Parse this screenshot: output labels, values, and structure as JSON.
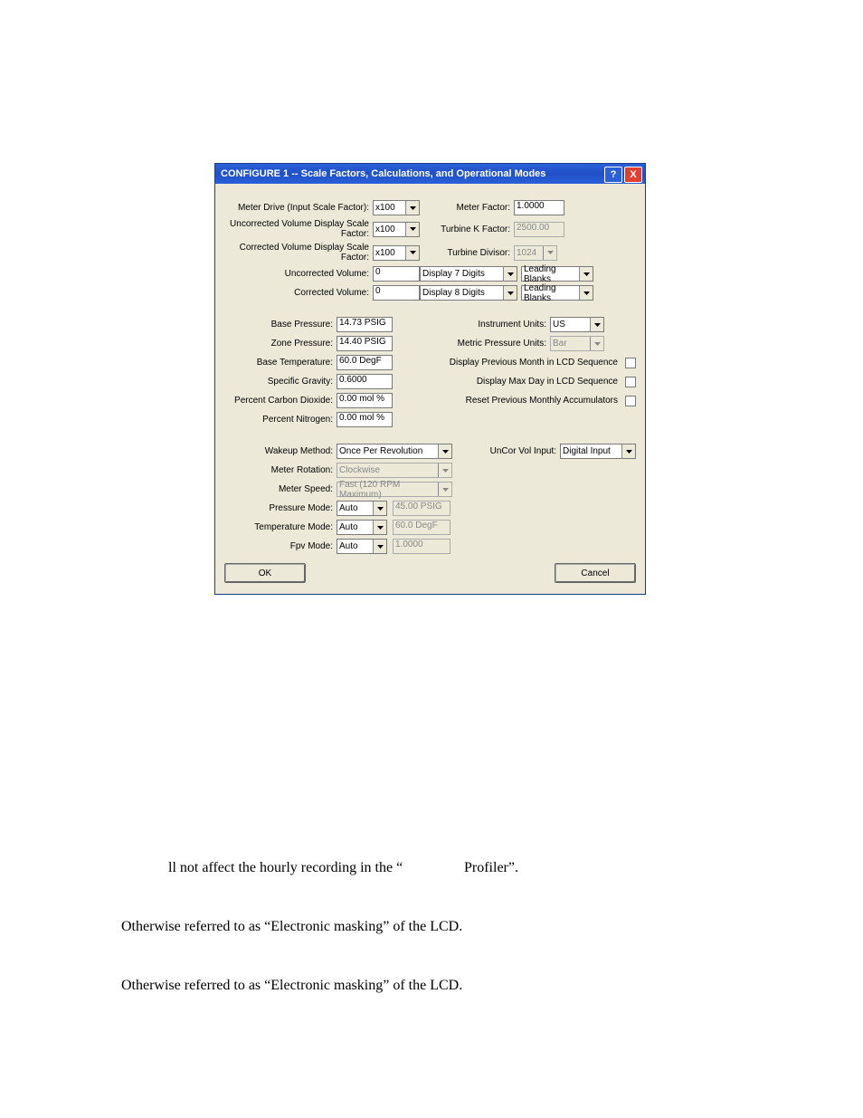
{
  "dialog": {
    "title": "CONFIGURE 1 -- Scale Factors, Calculations, and Operational Modes",
    "help": "?",
    "close": "X"
  },
  "left": {
    "meter_drive_lbl": "Meter Drive (Input Scale Factor):",
    "meter_drive_val": "x100",
    "uncorr_disp_lbl": "Uncorrected Volume Display Scale Factor:",
    "uncorr_disp_val": "x100",
    "corr_disp_lbl": "Corrected Volume Display Scale Factor:",
    "corr_disp_val": "x100",
    "uncorr_vol_lbl": "Uncorrected Volume:",
    "uncorr_vol_val": "0",
    "corr_vol_lbl": "Corrected Volume:",
    "corr_vol_val": "0",
    "base_pressure_lbl": "Base Pressure:",
    "base_pressure_val": "14.73 PSIG",
    "zone_pressure_lbl": "Zone Pressure:",
    "zone_pressure_val": "14.40 PSIG",
    "base_temp_lbl": "Base Temperature:",
    "base_temp_val": "60.0 DegF",
    "specific_gravity_lbl": "Specific Gravity:",
    "specific_gravity_val": "0.6000",
    "pct_co2_lbl": "Percent Carbon Dioxide:",
    "pct_co2_val": "0.00 mol %",
    "pct_n2_lbl": "Percent Nitrogen:",
    "pct_n2_val": "0.00 mol %",
    "wakeup_lbl": "Wakeup Method:",
    "wakeup_val": "Once Per Revolution",
    "rotation_lbl": "Meter Rotation:",
    "rotation_val": "Clockwise",
    "speed_lbl": "Meter Speed:",
    "speed_val": "Fast (120 RPM Maximum)",
    "pressure_mode_lbl": "Pressure Mode:",
    "pressure_mode_val": "Auto",
    "pressure_fixed": "45.00 PSIG",
    "temp_mode_lbl": "Temperature Mode:",
    "temp_mode_val": "Auto",
    "temp_fixed": "60.0 DegF",
    "fpv_mode_lbl": "Fpv Mode:",
    "fpv_mode_val": "Auto",
    "fpv_fixed": "1.0000"
  },
  "right": {
    "meter_factor_lbl": "Meter Factor:",
    "meter_factor_val": "1.0000",
    "turbine_k_lbl": "Turbine K Factor:",
    "turbine_k_val": "2500.00",
    "turbine_div_lbl": "Turbine Divisor:",
    "turbine_div_val": "1024",
    "display7_val": "Display 7 Digits",
    "blanks7_val": "Leading Blanks",
    "display8_val": "Display 8 Digits",
    "blanks8_val": "Leading Blanks",
    "instr_units_lbl": "Instrument Units:",
    "instr_units_val": "US",
    "metric_press_lbl": "Metric Pressure Units:",
    "metric_press_val": "Bar",
    "prev_month_lbl": "Display Previous Month in LCD Sequence",
    "max_day_lbl": "Display Max Day in LCD Sequence",
    "reset_prev_lbl": "Reset Previous Monthly Accumulators",
    "uncor_input_lbl": "UnCor Vol Input:",
    "uncor_input_val": "Digital Input"
  },
  "buttons": {
    "ok": "OK",
    "cancel": "Cancel"
  },
  "page": {
    "line1a": "ll not affect the hourly recording in the “",
    "line1b": "Profiler”.",
    "line2": "Otherwise referred to as “Electronic masking” of the LCD.",
    "line3": "Otherwise referred to as “Electronic masking” of the LCD."
  }
}
